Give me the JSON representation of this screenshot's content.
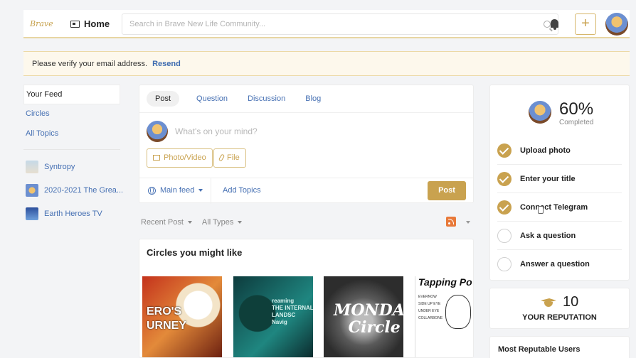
{
  "header": {
    "logo_text": "Brave",
    "home_label": "Home",
    "search_placeholder": "Search in Brave New Life Community...",
    "add_label": "+"
  },
  "banner": {
    "message": "Please verify your email address.",
    "link": "Resend"
  },
  "left_nav": {
    "items": [
      "Your Feed",
      "Circles",
      "All Topics"
    ],
    "groups": [
      "Syntropy",
      "2020-2021 The Grea...",
      "Earth Heroes TV"
    ]
  },
  "composer": {
    "tabs": [
      "Post",
      "Question",
      "Discussion",
      "Blog"
    ],
    "placeholder": "What's on your mind?",
    "photo_label": "Photo/Video",
    "file_label": "File",
    "feed_label": "Main feed",
    "topics_label": "Add Topics",
    "post_label": "Post"
  },
  "filters": {
    "sort": "Recent Post",
    "types": "All Types"
  },
  "circles": {
    "title": "Circles you might like",
    "cards": [
      {
        "text": "ERO'S\nURNEY"
      },
      {
        "text": "reaming\nTHE INTERNAL\nLANDSC\nNavig"
      },
      {
        "text": "MONDAY\nCircle"
      },
      {
        "text": "Tapping Po",
        "lines": "EVERNOW\nSIDE UP EYE\nUNDER EYE\nCOLLARBONE"
      }
    ]
  },
  "profile_progress": {
    "percent": "60%",
    "subtitle": "Completed",
    "steps": [
      {
        "label": "Upload photo",
        "done": true
      },
      {
        "label": "Enter your title",
        "done": true
      },
      {
        "label": "Connect Telegram",
        "done": true
      },
      {
        "label": "Ask a question",
        "done": false
      },
      {
        "label": "Answer a question",
        "done": false
      }
    ]
  },
  "reputation": {
    "value": "10",
    "label": "YOUR REPUTATION"
  },
  "most_reputable": {
    "title": "Most Reputable Users"
  },
  "colors": {
    "accent": "#c9a24f",
    "link": "#4670b3",
    "banner_bg": "#fdf8ec"
  }
}
